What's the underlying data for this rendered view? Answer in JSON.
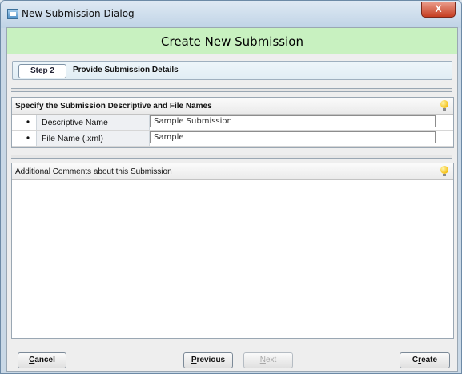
{
  "window": {
    "title": "New Submission Dialog",
    "close_label": "X"
  },
  "header": {
    "title": "Create New Submission"
  },
  "step": {
    "badge": "Step 2",
    "text": "Provide Submission Details"
  },
  "names_panel": {
    "title": "Specify the Submission Descriptive and File Names",
    "rows": [
      {
        "bullet": "•",
        "label": "Descriptive Name",
        "value": "Sample Submission"
      },
      {
        "bullet": "•",
        "label": "File Name (.xml)",
        "value": "Sample"
      }
    ]
  },
  "comments_panel": {
    "title": "Additional Comments about this Submission",
    "value": ""
  },
  "buttons": {
    "cancel": {
      "mnemonic": "C",
      "rest": "ancel"
    },
    "previous": {
      "mnemonic": "P",
      "rest": "revious"
    },
    "next": {
      "mnemonic": "N",
      "rest": "ext"
    },
    "create": {
      "prefix": "C",
      "mnemonic": "r",
      "rest": "eate"
    }
  }
}
